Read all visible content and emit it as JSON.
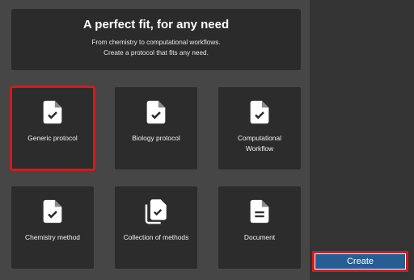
{
  "hero": {
    "title": "A perfect fit, for any need",
    "subtitle_line1": "From chemistry to computational workflows.",
    "subtitle_line2": "Create a protocol that fits any need."
  },
  "tiles": [
    {
      "label": "Generic protocol",
      "icon": "file-check-icon",
      "selected": true
    },
    {
      "label": "Biology protocol",
      "icon": "file-check-icon",
      "selected": false
    },
    {
      "label": "Computational",
      "label2": "Workflow",
      "icon": "file-check-icon",
      "selected": false
    },
    {
      "label": "Chemistry method",
      "icon": "file-check-icon",
      "selected": false
    },
    {
      "label": "Collection of methods",
      "icon": "file-stack-check-icon",
      "selected": false
    },
    {
      "label": "Document",
      "icon": "file-document-icon",
      "selected": false
    }
  ],
  "create_button": {
    "label": "Create"
  },
  "colors": {
    "background": "#464646",
    "sidebar": "#333333",
    "card": "#2c2c2c",
    "selection": "#d41a1a",
    "button": "#265d93"
  }
}
